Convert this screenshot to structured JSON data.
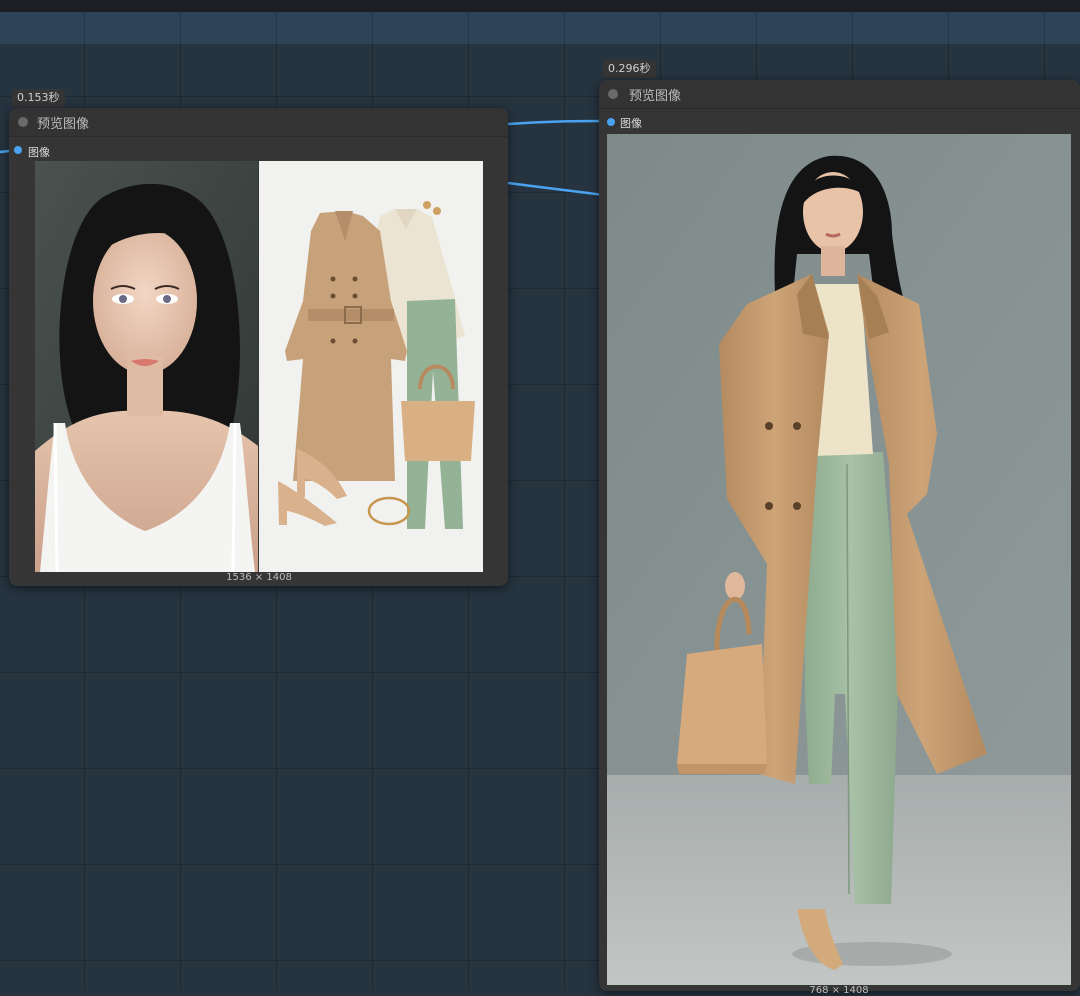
{
  "canvas": {
    "nodes": [
      {
        "timing": "0.153秒",
        "title": "预览图像",
        "input_label": "图像",
        "image_size": "1536 × 1408",
        "image_description": "Portrait of a woman with long black hair in a white camisole beside a flat-lay of a camel trench coat, cream blouse, sage green trousers, tan tote bag, nude heels and a gold bracelet"
      },
      {
        "timing": "0.296秒",
        "title": "预览图像",
        "input_label": "图像",
        "image_size": "768 × 1408",
        "image_description": "Full-length photo of the woman wearing the camel trench coat, cream blouse and sage green trousers, holding a tan tote bag, against a grey studio background"
      }
    ]
  },
  "colors": {
    "canvas_bg": "#263440",
    "node_bg": "#353535",
    "link": "#4aa3f0",
    "slot": "#4aa3f0"
  }
}
